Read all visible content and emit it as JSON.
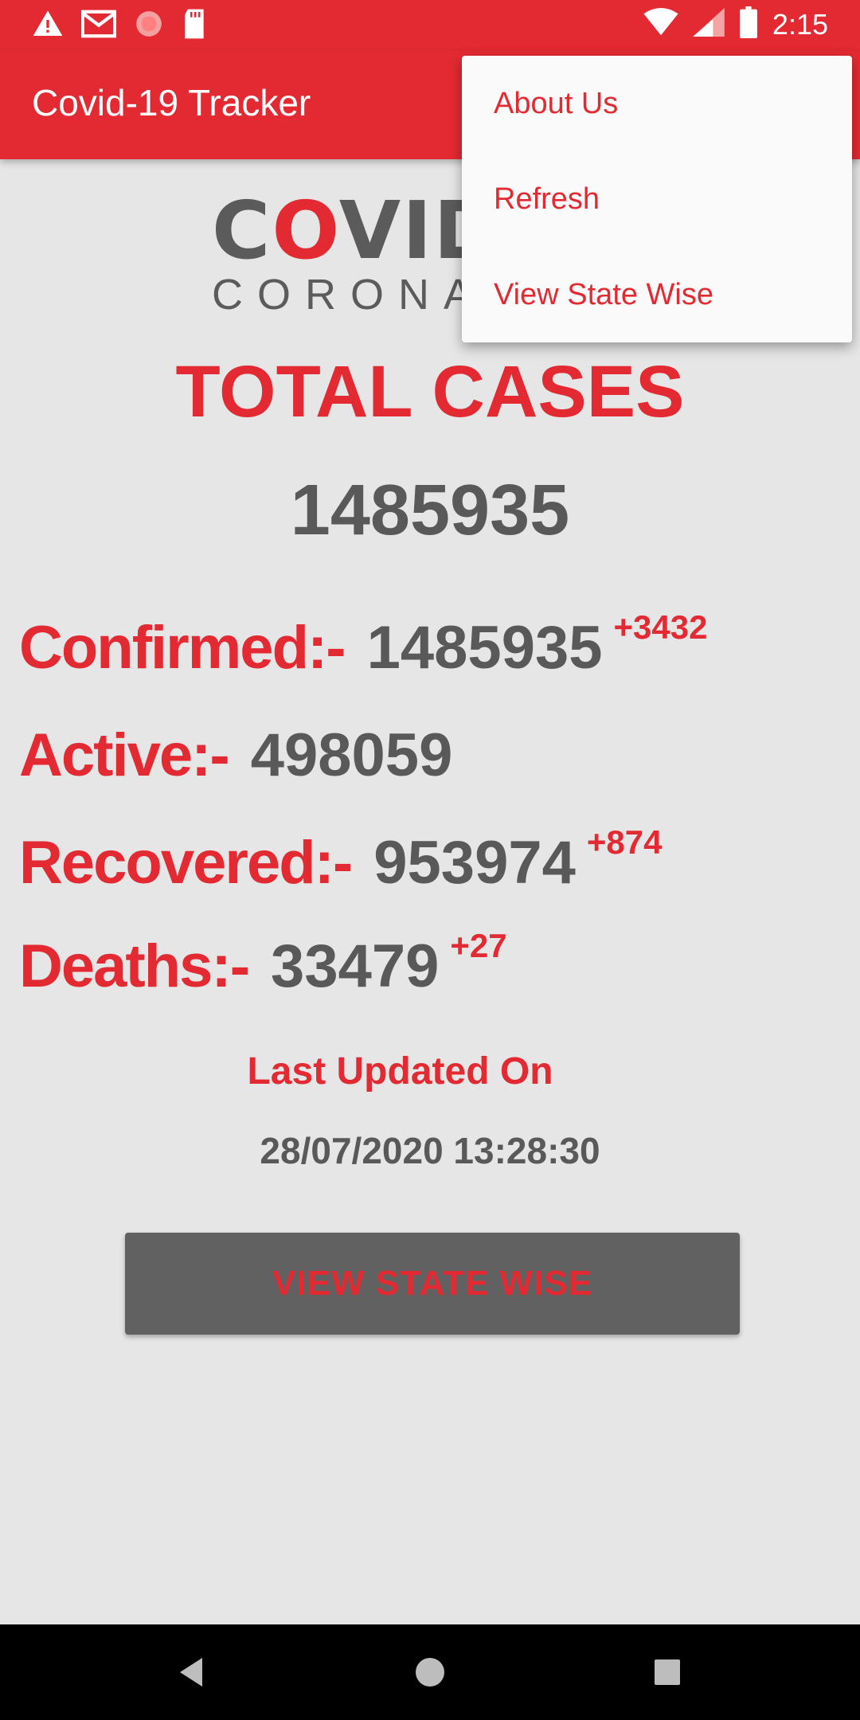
{
  "status_bar": {
    "time": "2:15",
    "icons": [
      "alert-icon",
      "gmail-icon",
      "app-icon",
      "sd-card-icon",
      "wifi-icon",
      "signal-icon",
      "battery-icon"
    ]
  },
  "app_bar": {
    "title": "Covid-19 Tracker"
  },
  "logo": {
    "big_text_1": "C",
    "big_text_o": "O",
    "big_text_2": "VID",
    "small_text": "CORONAVIRUS"
  },
  "total": {
    "label": "TOTAL CASES",
    "value": "1485935"
  },
  "stats": {
    "confirmed": {
      "label": "Confirmed:-",
      "value": "1485935",
      "delta": "+3432"
    },
    "active": {
      "label": "Active:-",
      "value": "498059"
    },
    "recovered": {
      "label": "Recovered:-",
      "value": "953974",
      "delta": "+874"
    },
    "deaths": {
      "label": "Deaths:-",
      "value": "33479",
      "delta": "+27"
    }
  },
  "updated": {
    "label": "Last Updated On",
    "value": "28/07/2020 13:28:30"
  },
  "button": {
    "label": "VIEW STATE WISE"
  },
  "menu": {
    "items": [
      "About Us",
      "Refresh",
      "View State Wise"
    ]
  },
  "colors": {
    "accent": "#e32a32",
    "text_gray": "#595959",
    "background": "#e6e6e6",
    "button_bg": "#616161"
  }
}
